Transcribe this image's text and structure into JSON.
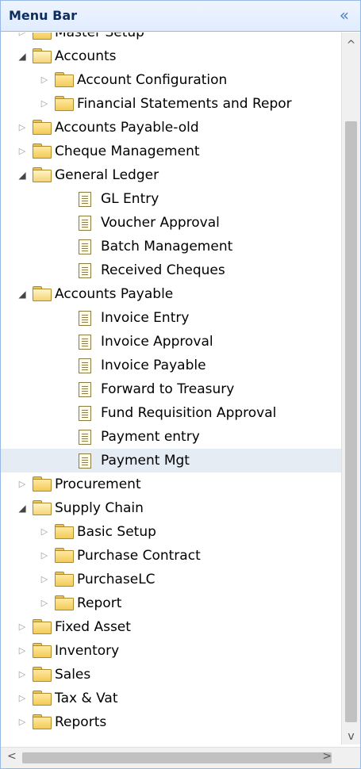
{
  "header": {
    "title": "Menu Bar",
    "collapse_icon": "«"
  },
  "tree": [
    {
      "label": "Master Setup",
      "type": "folder",
      "level": 1,
      "state": "collapsed"
    },
    {
      "label": "Accounts",
      "type": "folder",
      "level": 1,
      "state": "expanded"
    },
    {
      "label": "Account Configuration",
      "type": "folder",
      "level": 2,
      "state": "collapsed"
    },
    {
      "label": "Financial Statements and Repor",
      "type": "folder",
      "level": 2,
      "state": "collapsed"
    },
    {
      "label": "Accounts Payable-old",
      "type": "folder",
      "level": 1,
      "state": "collapsed"
    },
    {
      "label": "Cheque Management",
      "type": "folder",
      "level": 1,
      "state": "collapsed"
    },
    {
      "label": "General Ledger",
      "type": "folder",
      "level": 1,
      "state": "expanded"
    },
    {
      "label": "GL Entry",
      "type": "doc",
      "level": 2
    },
    {
      "label": "Voucher Approval",
      "type": "doc",
      "level": 2
    },
    {
      "label": "Batch Management",
      "type": "doc",
      "level": 2
    },
    {
      "label": "Received Cheques",
      "type": "doc",
      "level": 2
    },
    {
      "label": "Accounts Payable",
      "type": "folder",
      "level": 1,
      "state": "expanded"
    },
    {
      "label": "Invoice Entry",
      "type": "doc",
      "level": 2
    },
    {
      "label": "Invoice Approval",
      "type": "doc",
      "level": 2
    },
    {
      "label": "Invoice Payable",
      "type": "doc",
      "level": 2
    },
    {
      "label": "Forward to Treasury",
      "type": "doc",
      "level": 2
    },
    {
      "label": "Fund Requisition Approval",
      "type": "doc",
      "level": 2
    },
    {
      "label": "Payment entry",
      "type": "doc",
      "level": 2
    },
    {
      "label": "Payment Mgt",
      "type": "doc",
      "level": 2,
      "selected": true
    },
    {
      "label": "Procurement",
      "type": "folder",
      "level": 1,
      "state": "collapsed"
    },
    {
      "label": "Supply Chain",
      "type": "folder",
      "level": 1,
      "state": "expanded"
    },
    {
      "label": "Basic Setup",
      "type": "folder",
      "level": 2,
      "state": "collapsed"
    },
    {
      "label": "Purchase Contract",
      "type": "folder",
      "level": 2,
      "state": "collapsed"
    },
    {
      "label": "PurchaseLC",
      "type": "folder",
      "level": 2,
      "state": "collapsed"
    },
    {
      "label": "Report",
      "type": "folder",
      "level": 2,
      "state": "collapsed"
    },
    {
      "label": "Fixed Asset",
      "type": "folder",
      "level": 1,
      "state": "collapsed"
    },
    {
      "label": "Inventory",
      "type": "folder",
      "level": 1,
      "state": "collapsed"
    },
    {
      "label": "Sales",
      "type": "folder",
      "level": 1,
      "state": "collapsed"
    },
    {
      "label": "Tax & Vat",
      "type": "folder",
      "level": 1,
      "state": "collapsed"
    },
    {
      "label": "Reports",
      "type": "folder",
      "level": 1,
      "state": "collapsed"
    }
  ],
  "colors": {
    "header_bg": "#e0ecff",
    "border": "#95b8e7",
    "selected_bg": "#e6ecf4",
    "title": "#0e2d5f",
    "collapse_icon": "#4a80c8"
  }
}
